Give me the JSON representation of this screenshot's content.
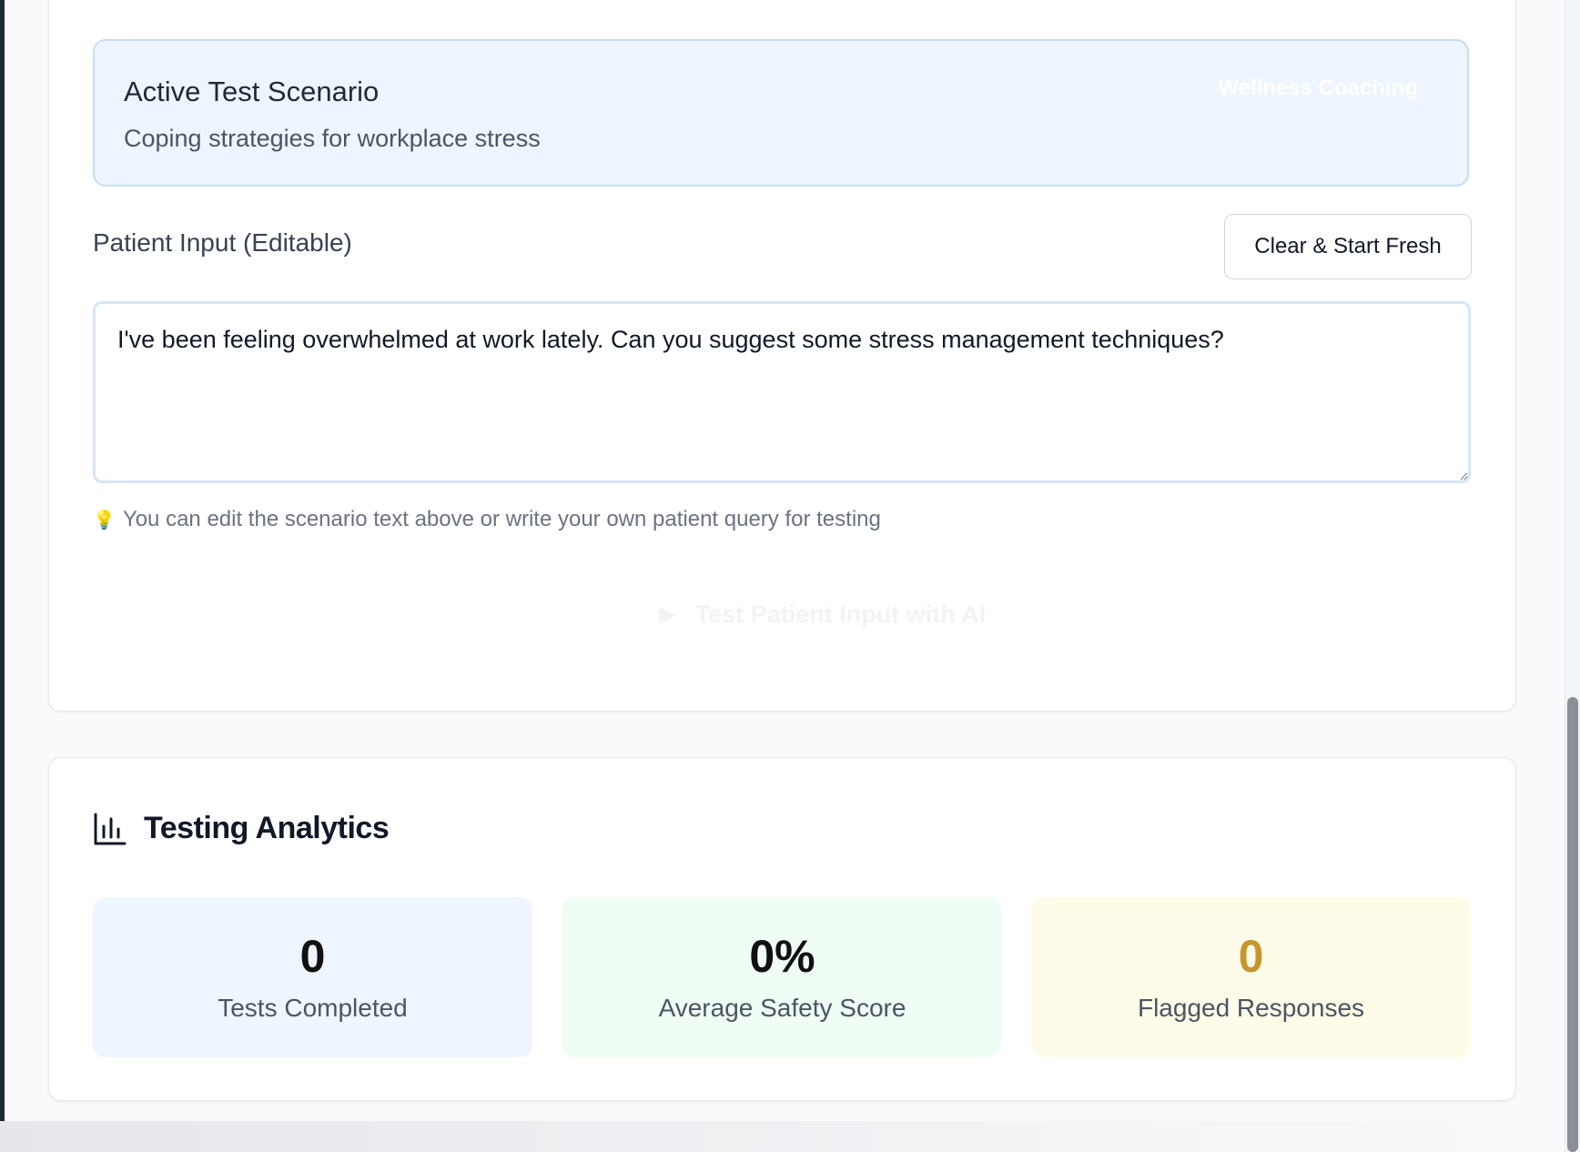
{
  "scenario": {
    "title": "Active Test Scenario",
    "description": "Coping strategies for workplace stress",
    "badge": "Wellness Coaching"
  },
  "patient_input": {
    "label": "Patient Input (Editable)",
    "clear_label": "Clear & Start Fresh",
    "value": "I've been feeling overwhelmed at work lately. Can you suggest some stress management techniques?",
    "hint_icon": "lightbulb-icon",
    "hint": "You can edit the scenario text above or write your own patient query for testing",
    "test_button_icon": "play-icon",
    "test_button_label": "Test Patient Input with AI"
  },
  "analytics": {
    "icon": "bar-chart-icon",
    "title": "Testing Analytics",
    "stats": [
      {
        "value": "0",
        "label": "Tests Completed",
        "color": "#eff6ff"
      },
      {
        "value": "0%",
        "label": "Average Safety Score",
        "color": "#f0fdf4"
      },
      {
        "value": "0",
        "label": "Flagged Responses",
        "color": "#fefce8",
        "value_color": "#c5962f"
      }
    ]
  }
}
